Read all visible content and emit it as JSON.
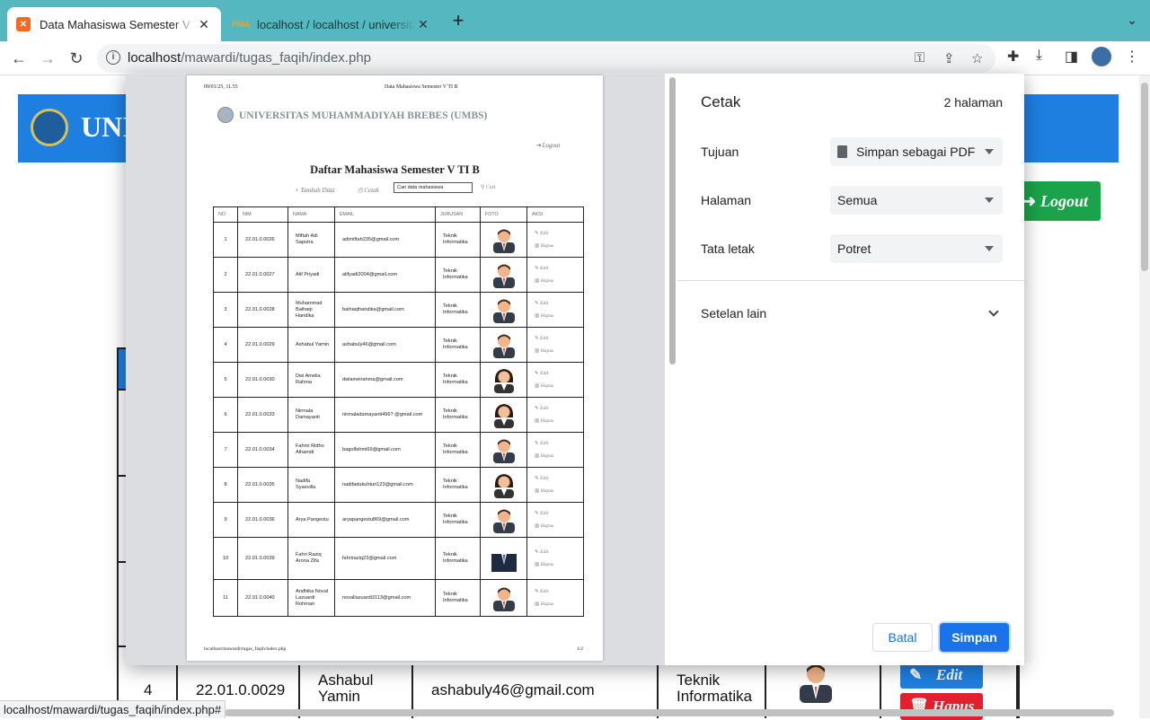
{
  "browser": {
    "tabs": [
      {
        "title": "Data Mahasiswa Semester V TI B",
        "favicon": "xampp-icon",
        "active": true
      },
      {
        "title": "localhost / localhost / universitas",
        "favicon": "phpmyadmin-icon",
        "active": false
      }
    ],
    "url_host": "localhost",
    "url_path": "/mawardi/tugas_faqih/index.php",
    "status_url": "localhost/mawardi/tugas_faqih/index.php#"
  },
  "page_behind": {
    "banner_text": "UNI",
    "logout_label": "Logout",
    "visible_row": {
      "no": "4",
      "nim": "22.01.0.0029",
      "nama": "Ashabul Yamin",
      "email": "ashabuly46@gmail.com",
      "jurusan": "Teknik Informatika",
      "edit_label": "Edit",
      "hapus_label": "Hapus"
    },
    "colors": {
      "banner": "#1e7fe0",
      "logout": "#1aa34a",
      "hapus": "#e0202c"
    }
  },
  "preview": {
    "header_left": "09/01/25, 11.55",
    "header_center": "Data Mahasiswa Semester V TI B",
    "university": "UNIVERSITAS MUHAMMADIYAH BREBES (UMBS)",
    "logout": "Logout",
    "title": "Daftar Mahasiswa Semester V TI B",
    "tambah": "Tambah Data",
    "cetak": "Cetak",
    "search_value": "Cari data mahasiswa",
    "cari": "Cari",
    "footer_left": "localhost/mawardi/tugas_faqih/index.php",
    "footer_right": "1/2",
    "columns": [
      "NO",
      "NIM",
      "NAMA",
      "EMAIL",
      "JURUSAN",
      "FOTO",
      "AKSI"
    ],
    "edit_label": "Edit",
    "hapus_label": "Hapus",
    "rows": [
      {
        "no": "1",
        "nim": "22.01.0.0026",
        "nama": "Miftah Adi Saputra",
        "email": "adimiftah235@gmail.com",
        "jurusan": "Teknik Informatika",
        "foto": "male"
      },
      {
        "no": "2",
        "nim": "22.01.0.0027",
        "nama": "Alif Priyadi",
        "email": "alifyadi2004@gmail.com",
        "jurusan": "Teknik Informatika",
        "foto": "male"
      },
      {
        "no": "3",
        "nim": "22.01.0.0028",
        "nama": "Muhammad Baihaqi Handika",
        "email": "baihaqihandika@gmail.com",
        "jurusan": "Teknik Informatika",
        "foto": "male"
      },
      {
        "no": "4",
        "nim": "22.01.0.0029",
        "nama": "Ashabul Yamin",
        "email": "ashabuly46@gmail.com",
        "jurusan": "Teknik Informatika",
        "foto": "male"
      },
      {
        "no": "5",
        "nim": "22.01.0.0030",
        "nama": "Dwi Amelia Rahma",
        "email": "dwiameirahma@gmail.com",
        "jurusan": "Teknik Informatika",
        "foto": "female"
      },
      {
        "no": "6",
        "nim": "22.01.0.0033",
        "nama": "Nirmala Damayanti",
        "email": "nirmaladamayanti496? @gmail.com",
        "jurusan": "Teknik Informatika",
        "foto": "female"
      },
      {
        "no": "7",
        "nim": "22.01.0.0034",
        "nama": "Fahmi Ridho Alhamdi",
        "email": "bagolfahmi69@gmail.com",
        "jurusan": "Teknik Informatika",
        "foto": "male"
      },
      {
        "no": "8",
        "nim": "22.01.0.0035",
        "nama": "Nadifa Syaevilla",
        "email": "nadifadukuhturi123@gmail.com",
        "jurusan": "Teknik Informatika",
        "foto": "female"
      },
      {
        "no": "9",
        "nim": "22.01.0.0036",
        "nama": "Arya Pangestu",
        "email": "aryapangestu869@gmail.com",
        "jurusan": "Teknik Informatika",
        "foto": "male"
      },
      {
        "no": "10",
        "nim": "22.01.0.0039",
        "nama": "Fahri Raziq Arona Zifa",
        "email": "fahriraziq23@gmail.com",
        "jurusan": "Teknik Informatika",
        "foto": "suit"
      },
      {
        "no": "11",
        "nim": "22.01.0.0040",
        "nama": "Andhika Noval Lazuardi Rohman",
        "email": "novallazuardi3113@gmail.com",
        "jurusan": "Teknik Informatika",
        "foto": "male"
      }
    ]
  },
  "print_settings": {
    "title": "Cetak",
    "page_count": "2 halaman",
    "destination_label": "Tujuan",
    "destination_value": "Simpan sebagai PDF",
    "pages_label": "Halaman",
    "pages_value": "Semua",
    "layout_label": "Tata letak",
    "layout_value": "Potret",
    "more_settings": "Setelan lain",
    "cancel": "Batal",
    "save": "Simpan",
    "accent": "#1a73e8"
  }
}
